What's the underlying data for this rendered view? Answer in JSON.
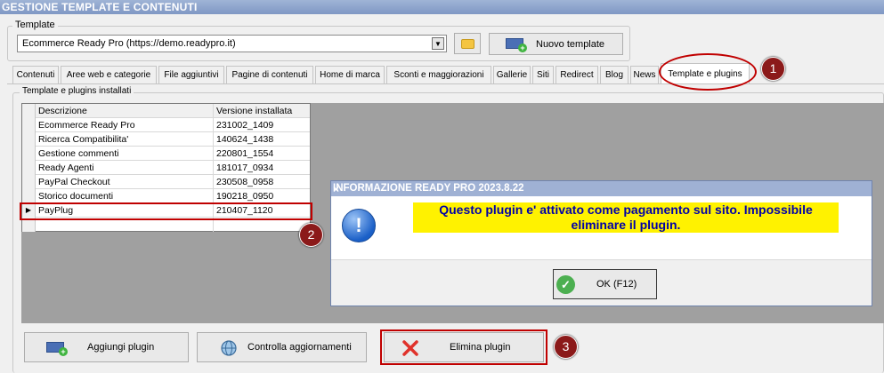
{
  "window": {
    "title": "GESTIONE TEMPLATE E CONTENUTI"
  },
  "template": {
    "label": "Template",
    "selected": "Ecommerce Ready Pro (https://demo.readypro.it)",
    "new_button": "Nuovo template"
  },
  "tabs": [
    "Contenuti",
    "Aree web e categorie",
    "File aggiuntivi",
    "Pagine di contenuti",
    "Home di marca",
    "Sconti e maggiorazioni",
    "Gallerie",
    "Siti",
    "Redirect",
    "Blog",
    "News",
    "Template e plugins"
  ],
  "plugins": {
    "group_label": "Template e plugins installati",
    "columns": [
      "Descrizione",
      "Versione installata"
    ],
    "rows": [
      [
        "Ecommerce Ready Pro",
        "231002_1409"
      ],
      [
        "Ricerca Compatibilita'",
        "140624_1438"
      ],
      [
        "Gestione commenti",
        "220801_1554"
      ],
      [
        "Ready Agenti",
        "181017_0934"
      ],
      [
        "PayPal Checkout",
        "230508_0958"
      ],
      [
        "Storico documenti",
        "190218_0950"
      ],
      [
        "PayPlug",
        "210407_1120"
      ]
    ]
  },
  "dialog": {
    "title": "INFORMAZIONE READY PRO 2023.8.22",
    "close": "×",
    "message_line1": "Questo plugin e' attivato come pagamento sul sito. Impossibile",
    "message_line2": "eliminare il plugin.",
    "ok_button": "OK (F12)"
  },
  "buttons": {
    "add_plugin": "Aggiungi plugin",
    "check_updates": "Controlla aggiornamenti",
    "delete_plugin": "Elimina plugin"
  },
  "annotations": [
    "1",
    "2",
    "3"
  ],
  "colors": {
    "highlight": "#c00000",
    "badge": "#8b1a1a",
    "message_bg": "#fff200",
    "message_text": "#0000a8"
  }
}
